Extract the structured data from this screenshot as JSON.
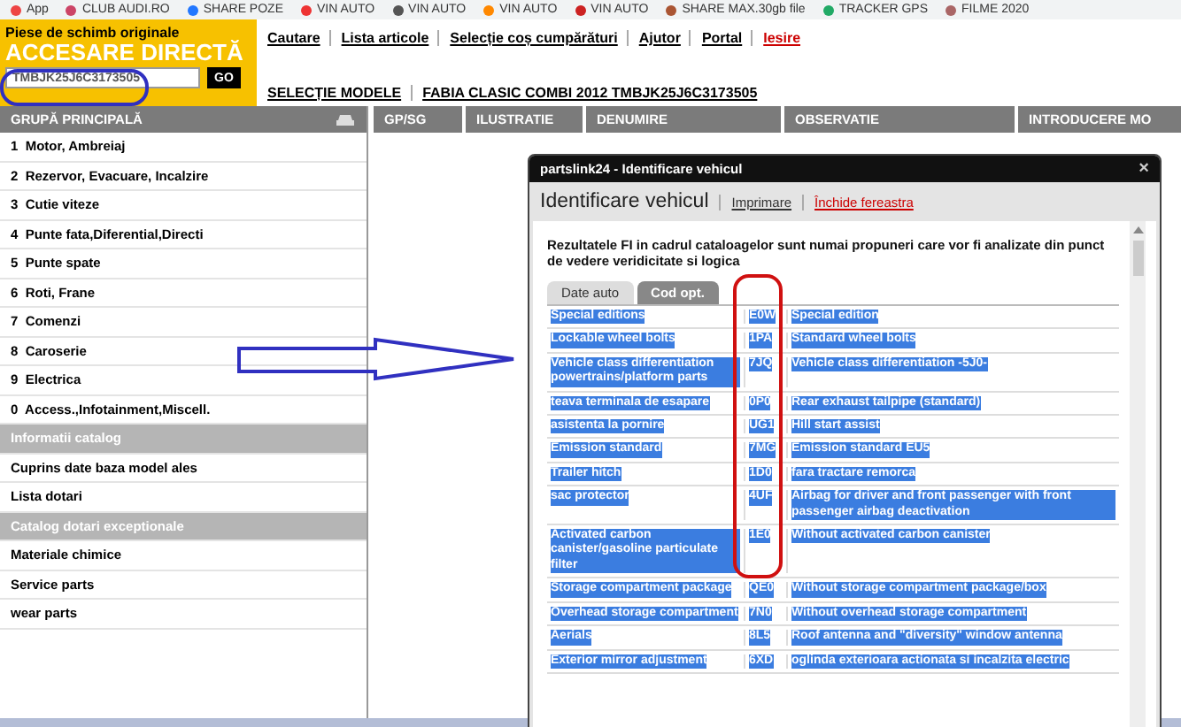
{
  "bookmarks": [
    {
      "label": "App"
    },
    {
      "label": "CLUB AUDI.RO"
    },
    {
      "label": "SHARE POZE"
    },
    {
      "label": "VIN AUTO"
    },
    {
      "label": "VIN AUTO"
    },
    {
      "label": "VIN AUTO"
    },
    {
      "label": "VIN AUTO"
    },
    {
      "label": "SHARE MAX.30gb file"
    },
    {
      "label": "TRACKER GPS"
    },
    {
      "label": "FILME 2020"
    }
  ],
  "brand": {
    "tagline": "Piese de schimb originale",
    "title": "ACCESARE DIRECTĂ",
    "vin": "TMBJK25J6C3173505",
    "go": "GO"
  },
  "nav": [
    {
      "label": "Cautare",
      "kind": "link"
    },
    {
      "label": "Lista articole",
      "kind": "link"
    },
    {
      "label": "Selecție coș cumpărături",
      "kind": "link"
    },
    {
      "label": "Ajutor",
      "kind": "link"
    },
    {
      "label": "Portal",
      "kind": "link"
    },
    {
      "label": "Iesire",
      "kind": "exit"
    }
  ],
  "breadcrumb": [
    "SELECȚIE MODELE",
    "FABIA CLASIC COMBI 2012 TMBJK25J6C3173505"
  ],
  "sidebar": {
    "title": "GRUPĂ PRINCIPALĂ",
    "items": [
      {
        "label": "1  Motor, Ambreiaj",
        "kind": "item"
      },
      {
        "label": "2  Rezervor, Evacuare, Incalzire",
        "kind": "item"
      },
      {
        "label": "3  Cutie viteze",
        "kind": "item"
      },
      {
        "label": "4  Punte fata,Diferential,Directi",
        "kind": "item"
      },
      {
        "label": "5  Punte spate",
        "kind": "item"
      },
      {
        "label": "6  Roti, Frane",
        "kind": "item"
      },
      {
        "label": "7  Comenzi",
        "kind": "item"
      },
      {
        "label": "8  Caroserie",
        "kind": "item"
      },
      {
        "label": "9  Electrica",
        "kind": "item"
      },
      {
        "label": "0  Access.,Infotainment,Miscell.",
        "kind": "item"
      },
      {
        "label": "Informatii catalog",
        "kind": "section"
      },
      {
        "label": "Cuprins date baza model ales",
        "kind": "item"
      },
      {
        "label": "Lista dotari",
        "kind": "item"
      },
      {
        "label": "Catalog dotari exceptionale",
        "kind": "section"
      },
      {
        "label": "Materiale chimice",
        "kind": "item"
      },
      {
        "label": "Service parts",
        "kind": "item"
      },
      {
        "label": "wear parts",
        "kind": "item"
      }
    ]
  },
  "columns": [
    "GP/SG",
    "ILUSTRATIE",
    "DENUMIRE",
    "OBSERVATIE",
    "INTRODUCERE MO"
  ],
  "modal": {
    "title": "partslink24 - Identificare vehicul",
    "close": "×",
    "heading": "Identificare vehicul",
    "links": [
      {
        "label": "Imprimare",
        "kind": "link"
      },
      {
        "label": "Închide fereastra",
        "kind": "exit"
      }
    ],
    "intro": "Rezultatele FI in cadrul cataloagelor sunt numai propuneri care vor fi analizate din punct de vedere veridicitate si logica",
    "tabs": [
      {
        "label": "Date auto",
        "selected": false
      },
      {
        "label": "Cod opt.",
        "selected": true
      }
    ],
    "rows": [
      {
        "name": "Special editions",
        "code": "E0W",
        "description": "Special edition"
      },
      {
        "name": "Lockable wheel bolts",
        "code": "1PA",
        "description": "Standard wheel bolts"
      },
      {
        "name": "Vehicle class differentiation powertrains/platform parts",
        "code": "7JQ",
        "description": "Vehicle class differentiation -5J0-"
      },
      {
        "name": "teava terminala de esapare",
        "code": "0P0",
        "description": "Rear exhaust tailpipe (standard)"
      },
      {
        "name": "asistenta la pornire",
        "code": "UG1",
        "description": "Hill start assist"
      },
      {
        "name": "Emission standard",
        "code": "7MG",
        "description": "Emission standard EU5"
      },
      {
        "name": "Trailer hitch",
        "code": "1D0",
        "description": "fara tractare remorca"
      },
      {
        "name": "sac protector",
        "code": "4UF",
        "description": "Airbag for driver and front passenger with front passenger airbag deactivation"
      },
      {
        "name": "Activated carbon canister/gasoline particulate filter",
        "code": "1E0",
        "description": "Without activated carbon canister"
      },
      {
        "name": "Storage compartment package",
        "code": "QE0",
        "description": "Without storage compartment package/box"
      },
      {
        "name": "Overhead storage compartment",
        "code": "7N0",
        "description": "Without overhead storage compartment"
      },
      {
        "name": "Aerials",
        "code": "8L5",
        "description": "Roof antenna and \"diversity\" window antenna"
      },
      {
        "name": "Exterior mirror adjustment",
        "code": "6XD",
        "description": "oglinda exterioara actionata si incalzita electric"
      }
    ]
  }
}
